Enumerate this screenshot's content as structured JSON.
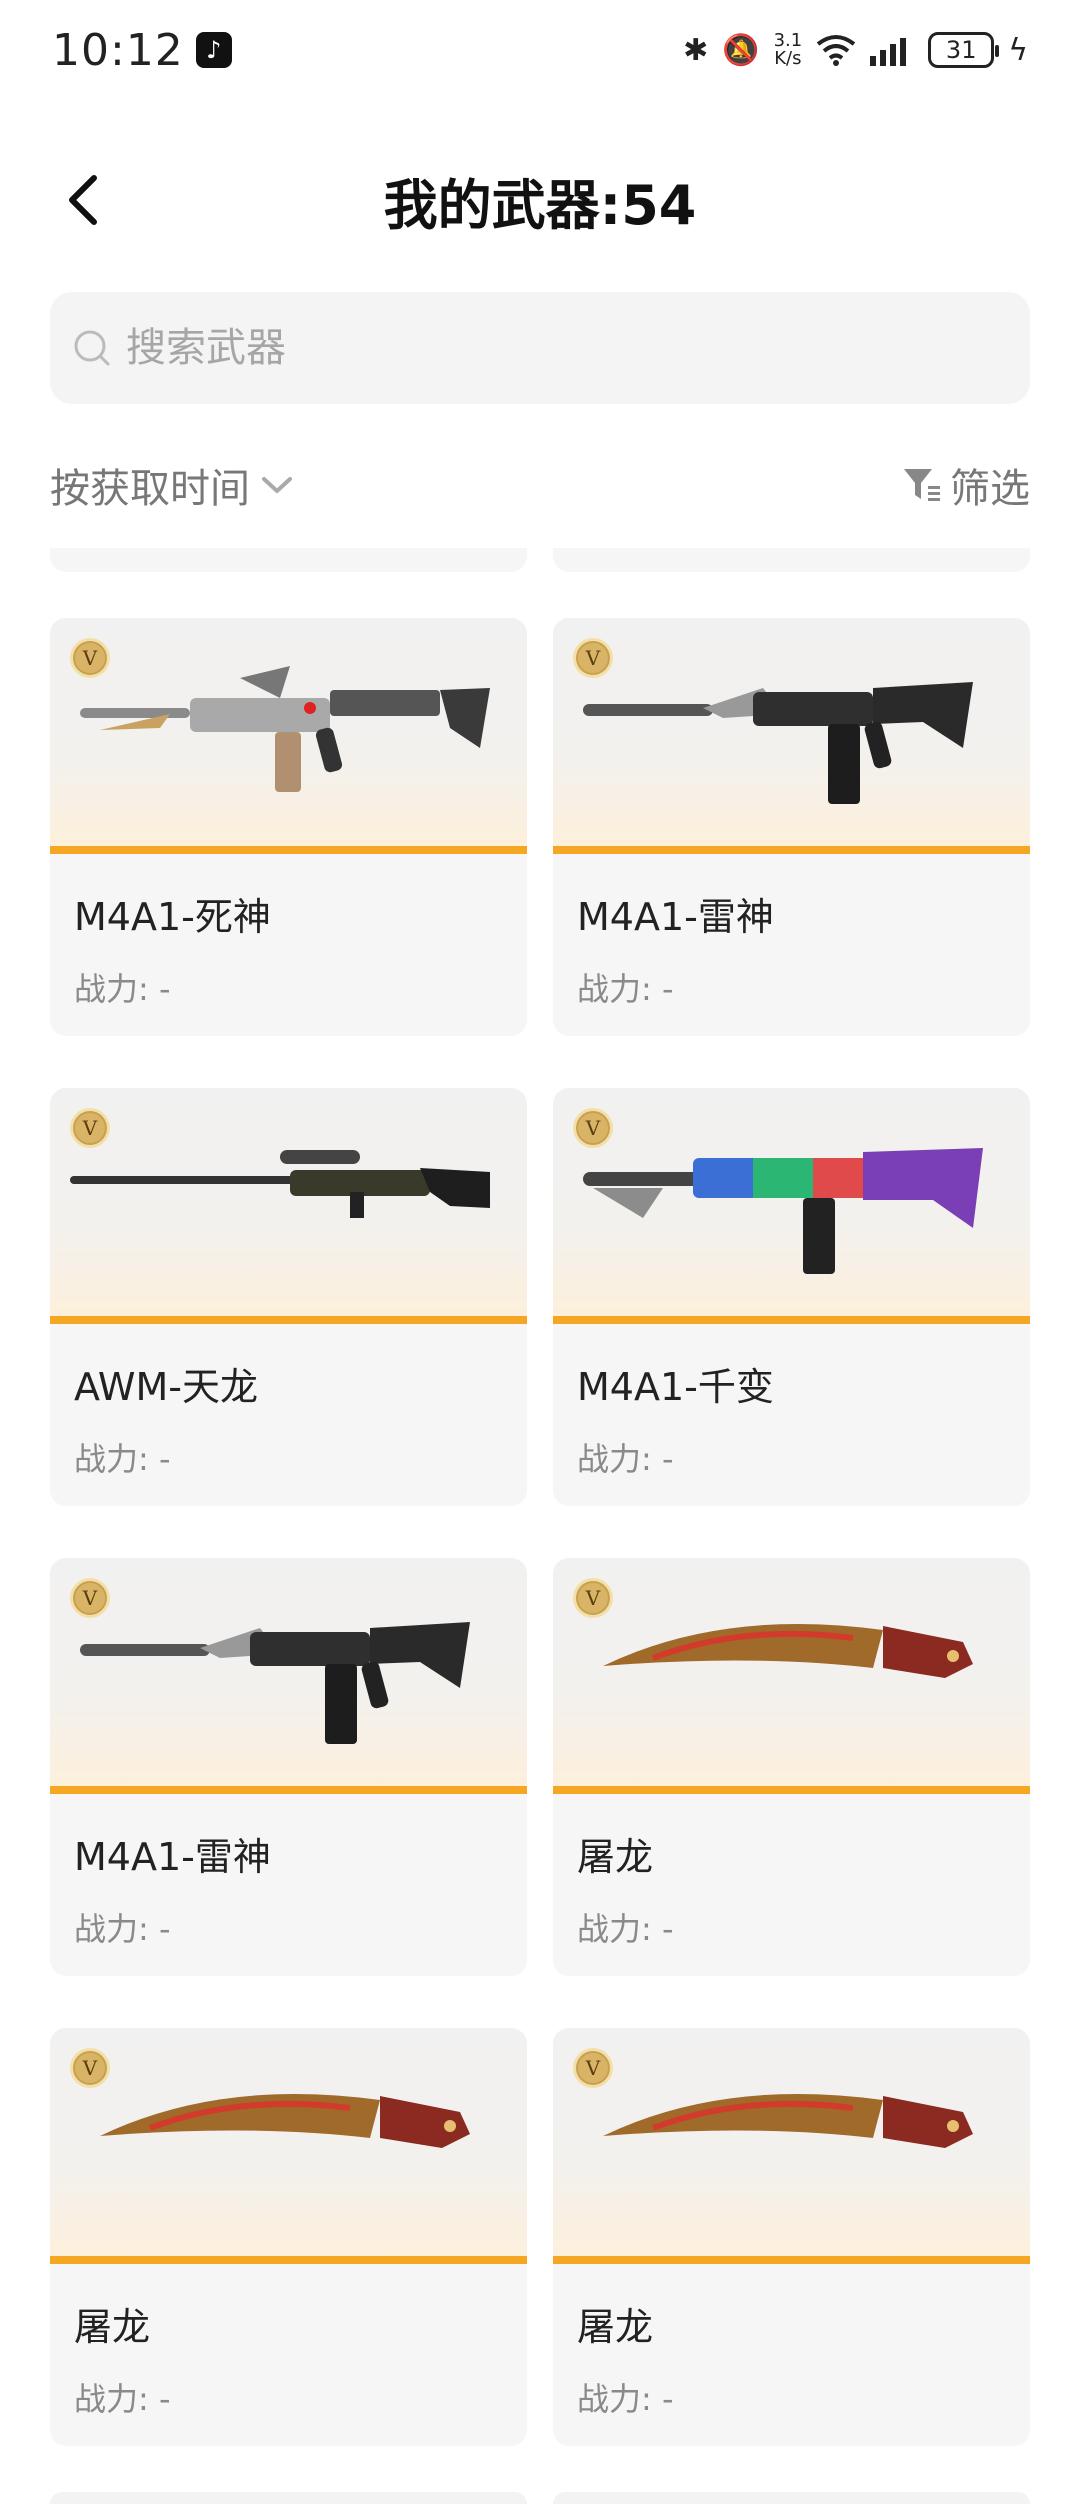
{
  "status_bar": {
    "time": "10:12",
    "speed_top": "3.1",
    "speed_bottom": "K/s",
    "battery": "31",
    "icons": [
      "tiktok-icon",
      "bluetooth-icon",
      "mute-icon",
      "wifi-icon",
      "signal-icon",
      "battery-icon",
      "charging-icon"
    ]
  },
  "header": {
    "title": "我的武器:54",
    "back_icon": "chevron-left-icon"
  },
  "search": {
    "placeholder": "搜索武器"
  },
  "toolbar": {
    "sort_label": "按获取时间",
    "filter_label": "筛选"
  },
  "colors": {
    "accent_orange": "#f5a623",
    "card_bg": "#f6f6f6",
    "muted_text": "#8a8a8a"
  },
  "weapons": [
    {
      "name": "M4A1-死神",
      "power": "战力: -",
      "art": "rifle-silver"
    },
    {
      "name": "M4A1-雷神",
      "power": "战力: -",
      "art": "rifle-black"
    },
    {
      "name": "AWM-天龙",
      "power": "战力: -",
      "art": "sniper"
    },
    {
      "name": "M4A1-千变",
      "power": "战力: -",
      "art": "rifle-rainbow"
    },
    {
      "name": "M4A1-雷神",
      "power": "战力: -",
      "art": "rifle-black"
    },
    {
      "name": "屠龙",
      "power": "战力: -",
      "art": "knife"
    },
    {
      "name": "屠龙",
      "power": "战力: -",
      "art": "knife"
    },
    {
      "name": "屠龙",
      "power": "战力: -",
      "art": "knife"
    }
  ]
}
